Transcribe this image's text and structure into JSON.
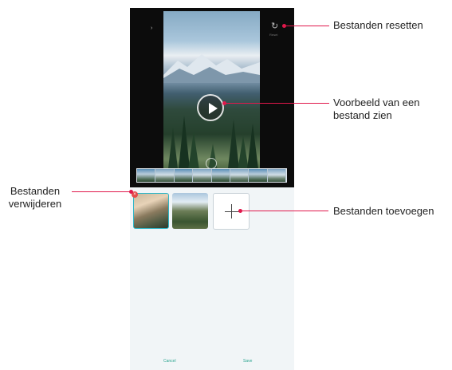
{
  "annotations": {
    "reset": "Bestanden resetten",
    "preview_line1": "Voorbeeld van een",
    "preview_line2": "bestand zien",
    "delete_line1": "Bestanden",
    "delete_line2": "verwijderen",
    "add": "Bestanden toevoegen"
  },
  "phone": {
    "reset_label": "Reset",
    "cancel": "Cancel",
    "save": "Save",
    "icons": [
      "play-icon",
      "reset-icon",
      "delete-icon",
      "add-icon",
      "rotate-icon"
    ]
  },
  "colors": {
    "accent": "#e0184b",
    "button_text": "#2aa48f"
  }
}
